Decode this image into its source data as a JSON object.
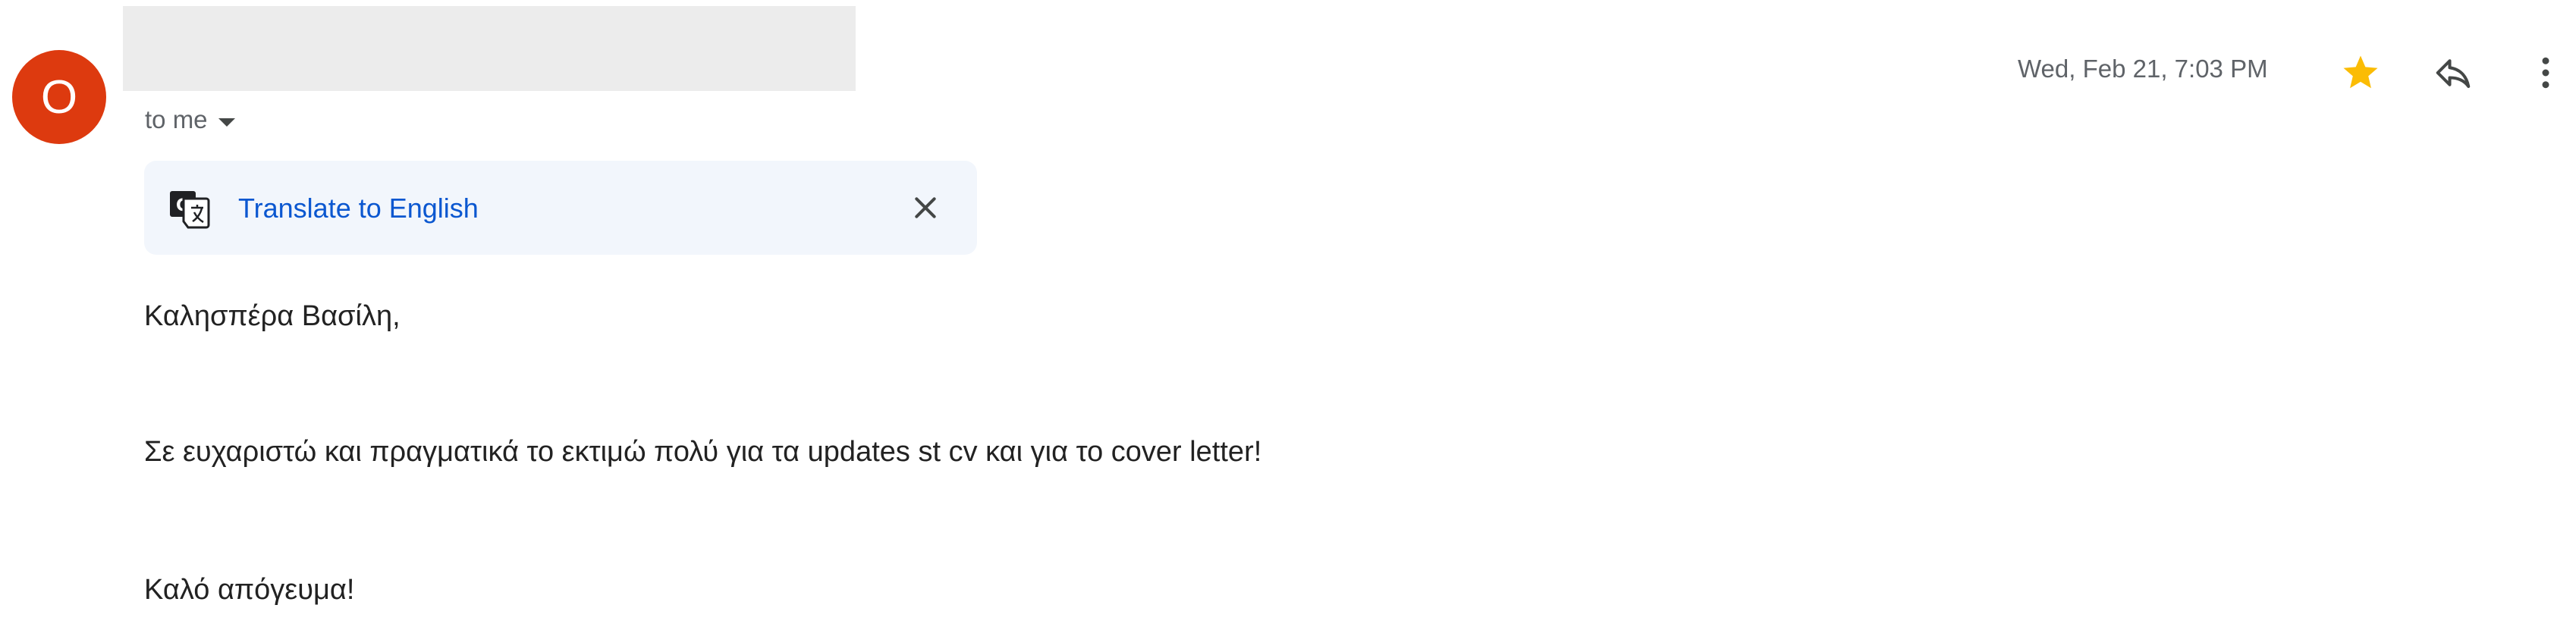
{
  "message": {
    "sender_initial": "O",
    "recipient_label": "to me",
    "date": "Wed, Feb 21, 7:03 PM",
    "starred": true,
    "colors": {
      "avatar": "#dd3a0f",
      "star": "#fbbc04",
      "link": "#0b57d0",
      "translate_bar_bg": "#f2f6fc",
      "redaction": "#ececec"
    },
    "icons": {
      "star": "star-icon",
      "reply": "reply-icon",
      "more": "more-vert-icon",
      "translate": "translate-icon",
      "close": "close-icon",
      "caret": "caret-down-icon"
    }
  },
  "translate_bar": {
    "link_label": "Translate to English"
  },
  "body": {
    "lines": [
      "Καλησπέρα Βασίλη,",
      "Σε ευχαριστώ και πραγματικά το εκτιμώ πολύ για τα updates st cv και για το cover letter!",
      "Καλό απόγευμα!"
    ]
  }
}
